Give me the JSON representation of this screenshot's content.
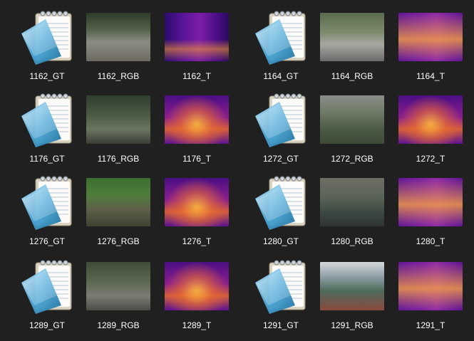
{
  "explorer": {
    "background_color": "#202020",
    "label_color": "#ffffff",
    "icons": {
      "gt_file_icon": "notepad-file-icon",
      "rgb_image_icon": "rgb-image-thumbnail",
      "t_image_icon": "thermal-image-thumbnail"
    },
    "items": [
      {
        "label": "1162_GT",
        "type": "gt"
      },
      {
        "label": "1162_RGB",
        "type": "rgb"
      },
      {
        "label": "1162_T",
        "type": "t"
      },
      {
        "label": "1164_GT",
        "type": "gt"
      },
      {
        "label": "1164_RGB",
        "type": "rgb"
      },
      {
        "label": "1164_T",
        "type": "t"
      },
      {
        "label": "1176_GT",
        "type": "gt"
      },
      {
        "label": "1176_RGB",
        "type": "rgb"
      },
      {
        "label": "1176_T",
        "type": "t"
      },
      {
        "label": "1272_GT",
        "type": "gt"
      },
      {
        "label": "1272_RGB",
        "type": "rgb"
      },
      {
        "label": "1272_T",
        "type": "t"
      },
      {
        "label": "1276_GT",
        "type": "gt"
      },
      {
        "label": "1276_RGB",
        "type": "rgb"
      },
      {
        "label": "1276_T",
        "type": "t"
      },
      {
        "label": "1280_GT",
        "type": "gt"
      },
      {
        "label": "1280_RGB",
        "type": "rgb"
      },
      {
        "label": "1280_T",
        "type": "t"
      },
      {
        "label": "1289_GT",
        "type": "gt"
      },
      {
        "label": "1289_RGB",
        "type": "rgb"
      },
      {
        "label": "1289_T",
        "type": "t"
      },
      {
        "label": "1291_GT",
        "type": "gt"
      },
      {
        "label": "1291_RGB",
        "type": "rgb"
      },
      {
        "label": "1291_T",
        "type": "t"
      }
    ]
  }
}
